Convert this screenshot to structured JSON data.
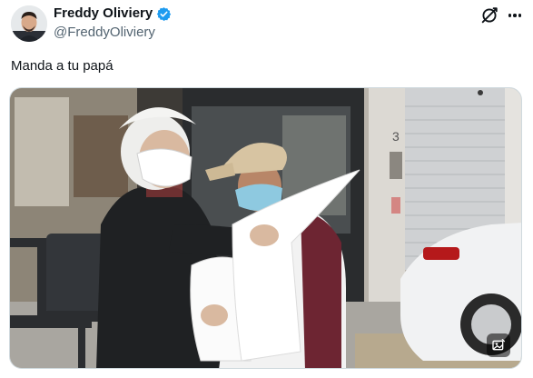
{
  "author": {
    "display_name": "Freddy Oliviery",
    "handle": "@FreddyOliviery"
  },
  "tweet": {
    "text": "Manda a tu papá"
  },
  "media": {
    "door_number": "3"
  },
  "icons": {
    "verified": "verified-badge-icon",
    "grok": "grok-icon",
    "more": "more-options-icon",
    "media_action": "media-edit-icon"
  },
  "colors": {
    "verified_blue": "#1d9bf0",
    "handle_gray": "#536471"
  }
}
